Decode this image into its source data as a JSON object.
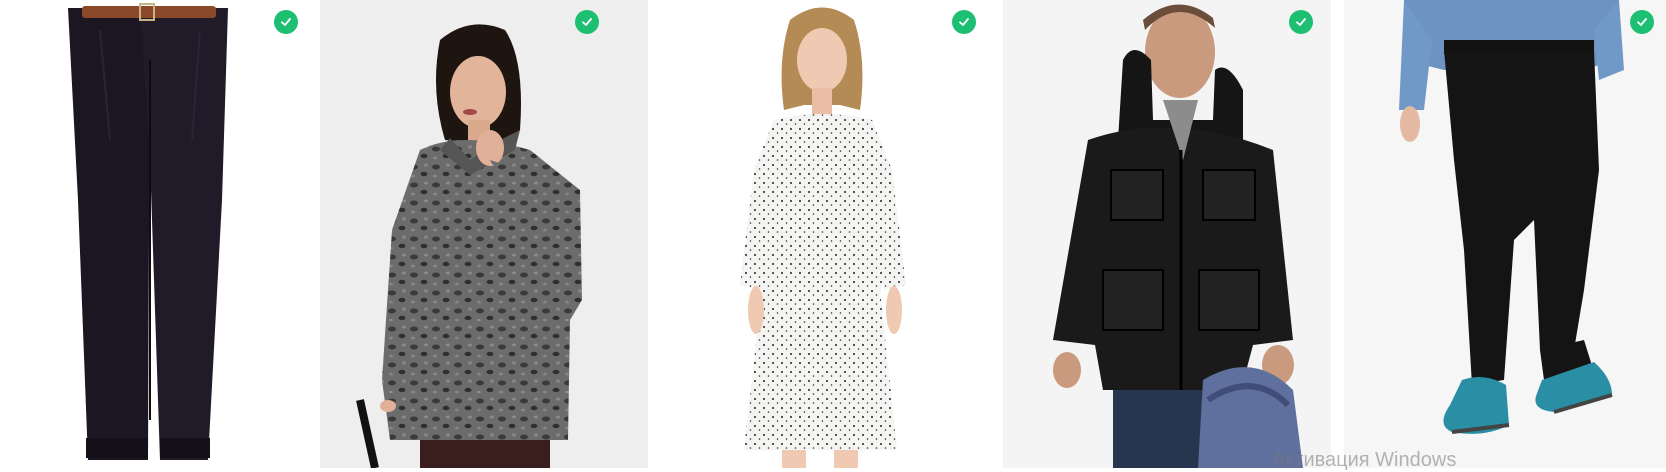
{
  "accent_color": "#1dbf73",
  "products": [
    {
      "id": "trousers-dark",
      "icon": "check-icon",
      "selected": true
    },
    {
      "id": "leopard-coat",
      "icon": "check-icon",
      "selected": true
    },
    {
      "id": "polka-dress",
      "icon": "check-icon",
      "selected": true
    },
    {
      "id": "black-jacket",
      "icon": "check-icon",
      "selected": true
    },
    {
      "id": "black-pants-blue-shoes",
      "icon": "check-icon",
      "selected": true
    }
  ],
  "watermark": {
    "text": "Активация Windows"
  }
}
